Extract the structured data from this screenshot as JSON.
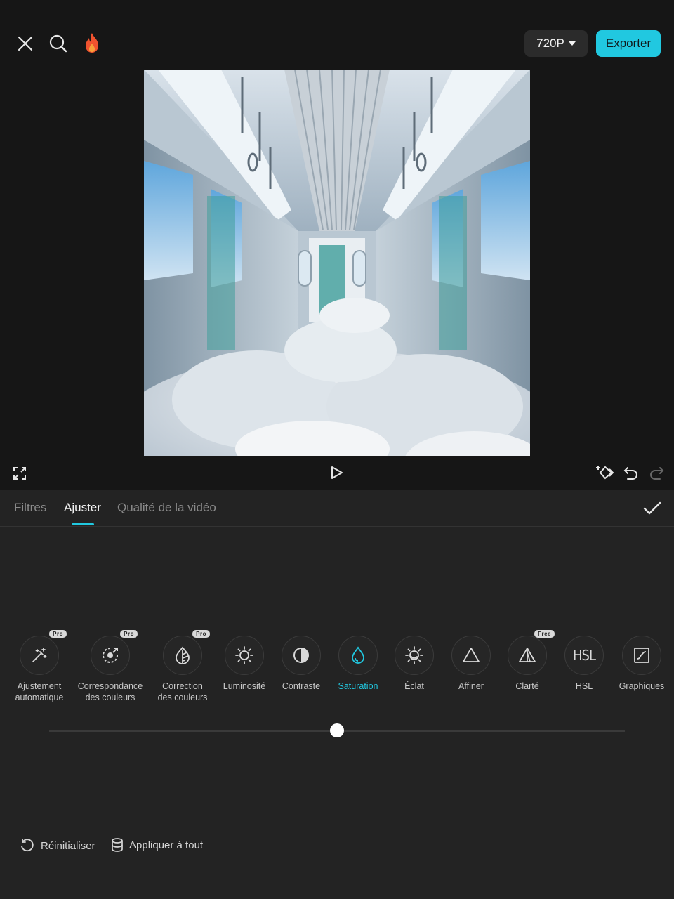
{
  "topbar": {
    "resolution": "720P",
    "export_label": "Exporter"
  },
  "tabs": [
    {
      "label": "Filtres",
      "active": false
    },
    {
      "label": "Ajuster",
      "active": true
    },
    {
      "label": "Qualité de la vidéo",
      "active": false
    }
  ],
  "tools": [
    {
      "label_lines": [
        "Ajustement",
        "automatique"
      ],
      "icon": "magic-wand-icon",
      "badge": "Pro"
    },
    {
      "label_lines": [
        "Correspondance",
        "des couleurs"
      ],
      "icon": "color-match-icon",
      "badge": "Pro"
    },
    {
      "label_lines": [
        "Correction",
        "des couleurs"
      ],
      "icon": "color-correction-icon",
      "badge": "Pro"
    },
    {
      "label_lines": [
        "Luminosité"
      ],
      "icon": "brightness-icon",
      "badge": ""
    },
    {
      "label_lines": [
        "Contraste"
      ],
      "icon": "contrast-icon",
      "badge": ""
    },
    {
      "label_lines": [
        "Saturation"
      ],
      "icon": "saturation-icon",
      "badge": "",
      "active": true
    },
    {
      "label_lines": [
        "Éclat"
      ],
      "icon": "exposure-icon",
      "badge": ""
    },
    {
      "label_lines": [
        "Affiner"
      ],
      "icon": "sharpen-icon",
      "badge": ""
    },
    {
      "label_lines": [
        "Clarté"
      ],
      "icon": "clarity-icon",
      "badge": "Free"
    },
    {
      "label_lines": [
        "HSL"
      ],
      "icon": "hsl-icon",
      "badge": ""
    },
    {
      "label_lines": [
        "Graphiques"
      ],
      "icon": "curves-icon",
      "badge": ""
    }
  ],
  "slider": {
    "value": 0.5
  },
  "bottom": {
    "reset_label": "Réinitialiser",
    "apply_all_label": "Appliquer à tout"
  },
  "colors": {
    "accent": "#21c8e0",
    "background": "#161616",
    "panel": "#232323"
  }
}
